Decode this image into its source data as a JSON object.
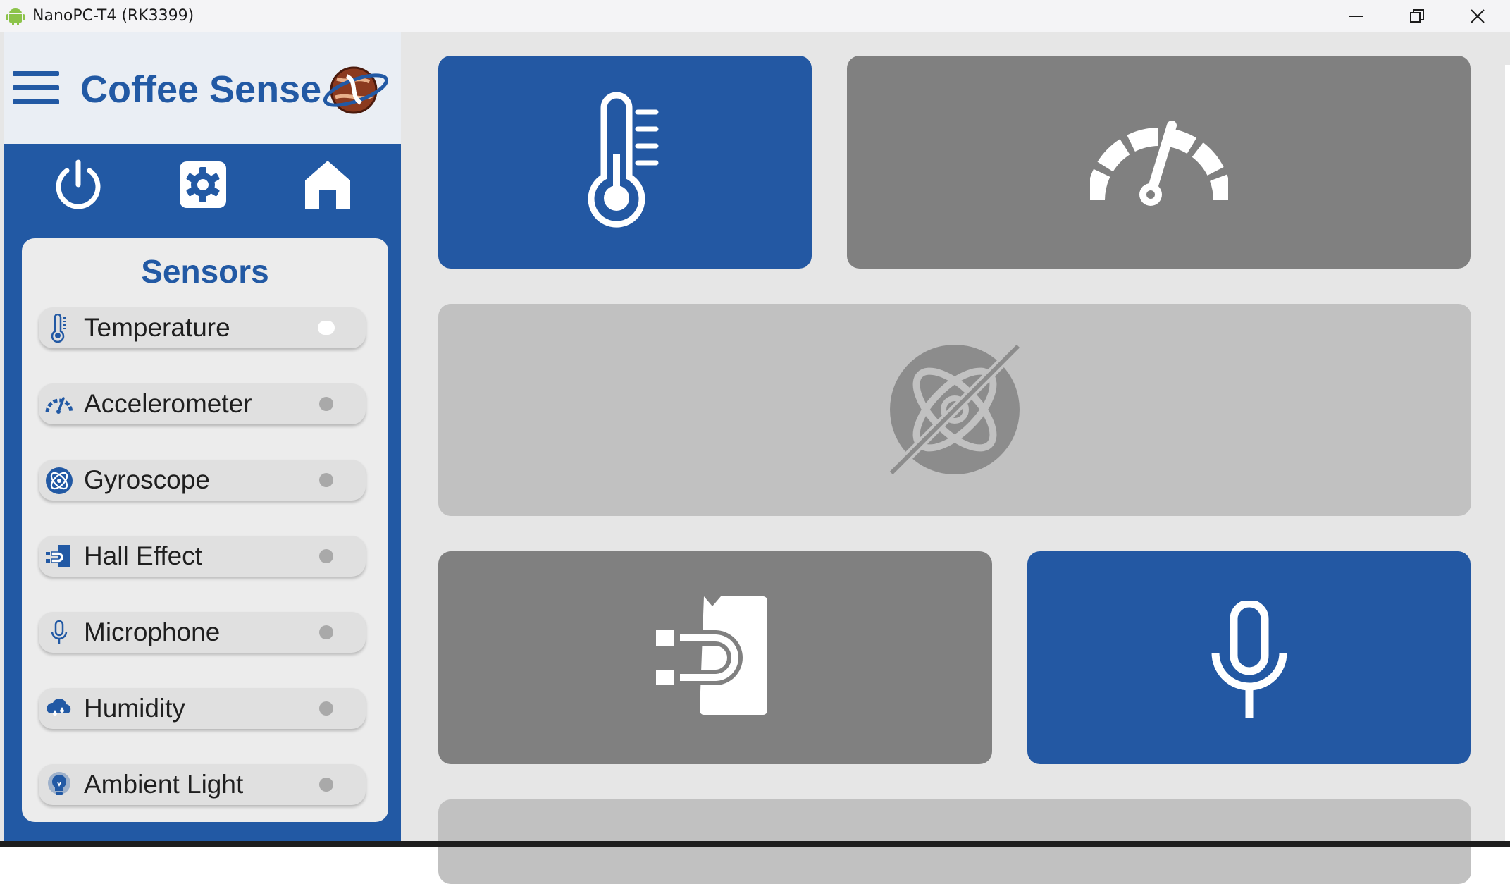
{
  "window": {
    "title": "NanoPC-T4 (RK3399)",
    "icon": "android-icon",
    "controls": [
      "minimize",
      "maximize",
      "close"
    ]
  },
  "header": {
    "app_title": "Coffee Sense",
    "menu_icon": "hamburger-menu-icon",
    "logo_icon": "globe-logo-icon"
  },
  "toolbar": [
    {
      "name": "power-icon"
    },
    {
      "name": "settings-icon"
    },
    {
      "name": "home-icon"
    }
  ],
  "sensors": {
    "title": "Sensors",
    "items": [
      {
        "label": "Temperature",
        "icon": "thermometer-icon",
        "enabled": true
      },
      {
        "label": "Accelerometer",
        "icon": "speedometer-icon",
        "enabled": false
      },
      {
        "label": "Gyroscope",
        "icon": "gyroscope-icon",
        "enabled": false
      },
      {
        "label": "Hall Effect",
        "icon": "magnet-icon",
        "enabled": false
      },
      {
        "label": "Microphone",
        "icon": "microphone-icon",
        "enabled": false
      },
      {
        "label": "Humidity",
        "icon": "humidity-icon",
        "enabled": false
      },
      {
        "label": "Ambient Light",
        "icon": "light-bulb-icon",
        "enabled": false
      }
    ]
  },
  "tiles": [
    {
      "name": "temperature",
      "icon": "thermometer-icon",
      "state": "active"
    },
    {
      "name": "accelerometer",
      "icon": "speedometer-icon",
      "state": "inactive"
    },
    {
      "name": "gyroscope",
      "icon": "gyroscope-off-icon",
      "state": "unavailable"
    },
    {
      "name": "hall-effect",
      "icon": "magnet-icon",
      "state": "inactive"
    },
    {
      "name": "microphone",
      "icon": "microphone-icon",
      "state": "active"
    }
  ],
  "colors": {
    "primary": "#2259a4",
    "tile_inactive": "#808080",
    "tile_unavailable": "#c1c1c1",
    "background": "#e6e6e6"
  }
}
